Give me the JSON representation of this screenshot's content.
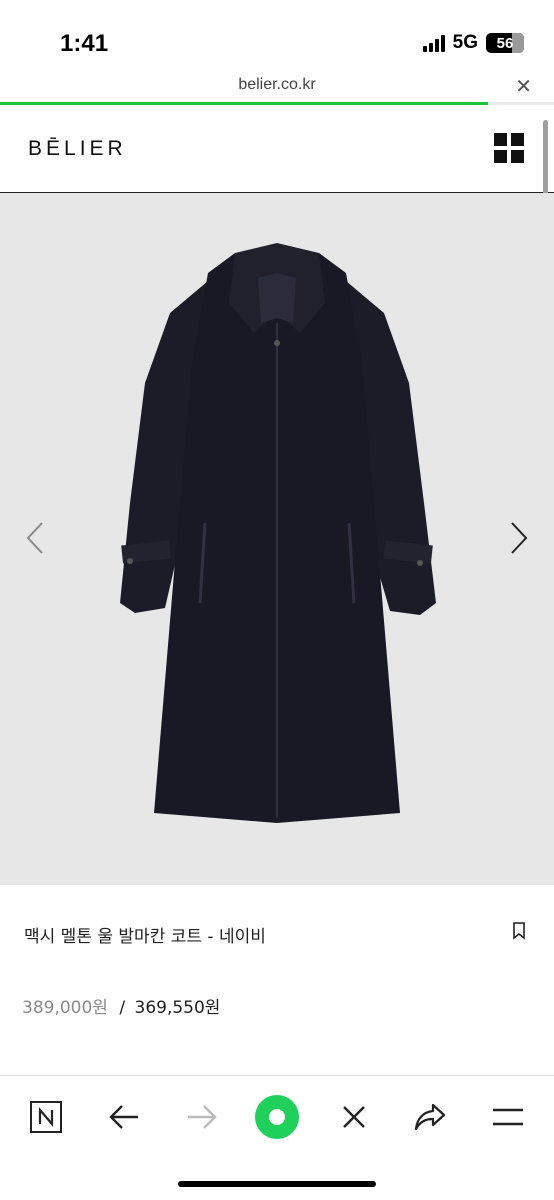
{
  "status_bar": {
    "time": "1:41",
    "network": "5G",
    "battery": "56"
  },
  "browser": {
    "url": "belier.co.kr",
    "close_icon": "close-icon",
    "load_progress": 0.88,
    "accent_color": "#1fc23c"
  },
  "site": {
    "logo": "BĒLIER",
    "menu_icon": "grid-menu-icon"
  },
  "gallery": {
    "prev_icon": "chevron-left-icon",
    "next_icon": "chevron-right-icon"
  },
  "product": {
    "name": "맥시 멜톤 울 발마칸 코트 - 네이비",
    "original_price": "389,000원",
    "price_separator": "/",
    "sale_price": "369,550원",
    "bookmark_icon": "bookmark-icon"
  },
  "toolbar": {
    "items": [
      "naver-home-icon",
      "back-arrow-icon",
      "forward-arrow-icon",
      "green-dot-icon",
      "close-icon",
      "share-icon",
      "menu-icon"
    ]
  }
}
